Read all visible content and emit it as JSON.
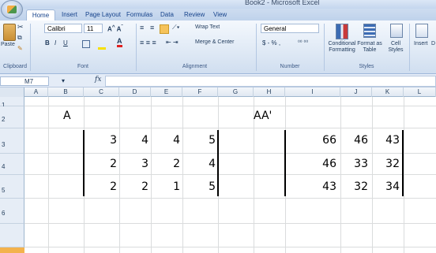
{
  "window": {
    "title": "Book2 - Microsoft Excel"
  },
  "tabs": [
    "Home",
    "Insert",
    "Page Layout",
    "Formulas",
    "Data",
    "Review",
    "View"
  ],
  "ribbon": {
    "clipboard": {
      "paste": "Paste",
      "group": "Clipboard"
    },
    "font": {
      "name": "Calibri",
      "size": "11",
      "group": "Font"
    },
    "alignment": {
      "wrap": "Wrap Text",
      "merge": "Merge & Center",
      "group": "Alignment"
    },
    "number": {
      "format": "General",
      "symbols": "$ - % ,",
      "group": "Number"
    },
    "styles": {
      "conditional": "Conditional Formatting",
      "format_table": "Format as Table",
      "cell_styles": "Cell Styles",
      "group": "Styles"
    },
    "cells": {
      "insert": "Insert",
      "delete": "D"
    }
  },
  "formula_bar": {
    "name_box": "M7",
    "fx": "fx",
    "value": ""
  },
  "columns": [
    "A",
    "B",
    "C",
    "D",
    "E",
    "F",
    "G",
    "H",
    "I",
    "J",
    "K",
    "L"
  ],
  "rows": [
    "1",
    "2",
    "3",
    "4",
    "5",
    "6"
  ],
  "sheet": {
    "label_a": "A",
    "label_aa": "AA'",
    "matrix_a": [
      [
        "3",
        "4",
        "4",
        "5"
      ],
      [
        "2",
        "3",
        "2",
        "4"
      ],
      [
        "2",
        "2",
        "1",
        "5"
      ]
    ],
    "matrix_aa": [
      [
        "66",
        "46",
        "43"
      ],
      [
        "46",
        "33",
        "32"
      ],
      [
        "43",
        "32",
        "34"
      ]
    ]
  }
}
